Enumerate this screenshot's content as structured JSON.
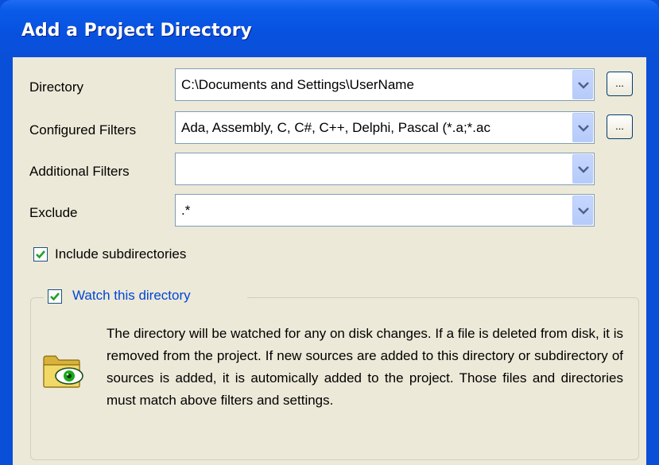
{
  "window": {
    "title": "Add a Project Directory"
  },
  "fields": {
    "directory": {
      "label": "Directory",
      "value": "C:\\Documents and Settings\\UserName"
    },
    "configured_filters": {
      "label": "Configured Filters",
      "value": "Ada, Assembly, C, C#, C++, Delphi, Pascal (*.a;*.ac"
    },
    "additional_filters": {
      "label": "Additional Filters",
      "value": ""
    },
    "exclude": {
      "label": "Exclude",
      "value": ".*"
    }
  },
  "browse_label": "...",
  "options": {
    "include_subdirectories": {
      "label": "Include subdirectories",
      "checked": true
    },
    "watch_directory": {
      "label": "Watch this directory",
      "checked": true
    }
  },
  "watch_description": "The directory will be watched for any on disk changes.  If a file is deleted from disk, it is removed from the project. If new sources are added to this directory or subdirectory of sources is added, it is automically added to the project.  Those files and directories must match above filters and settings."
}
